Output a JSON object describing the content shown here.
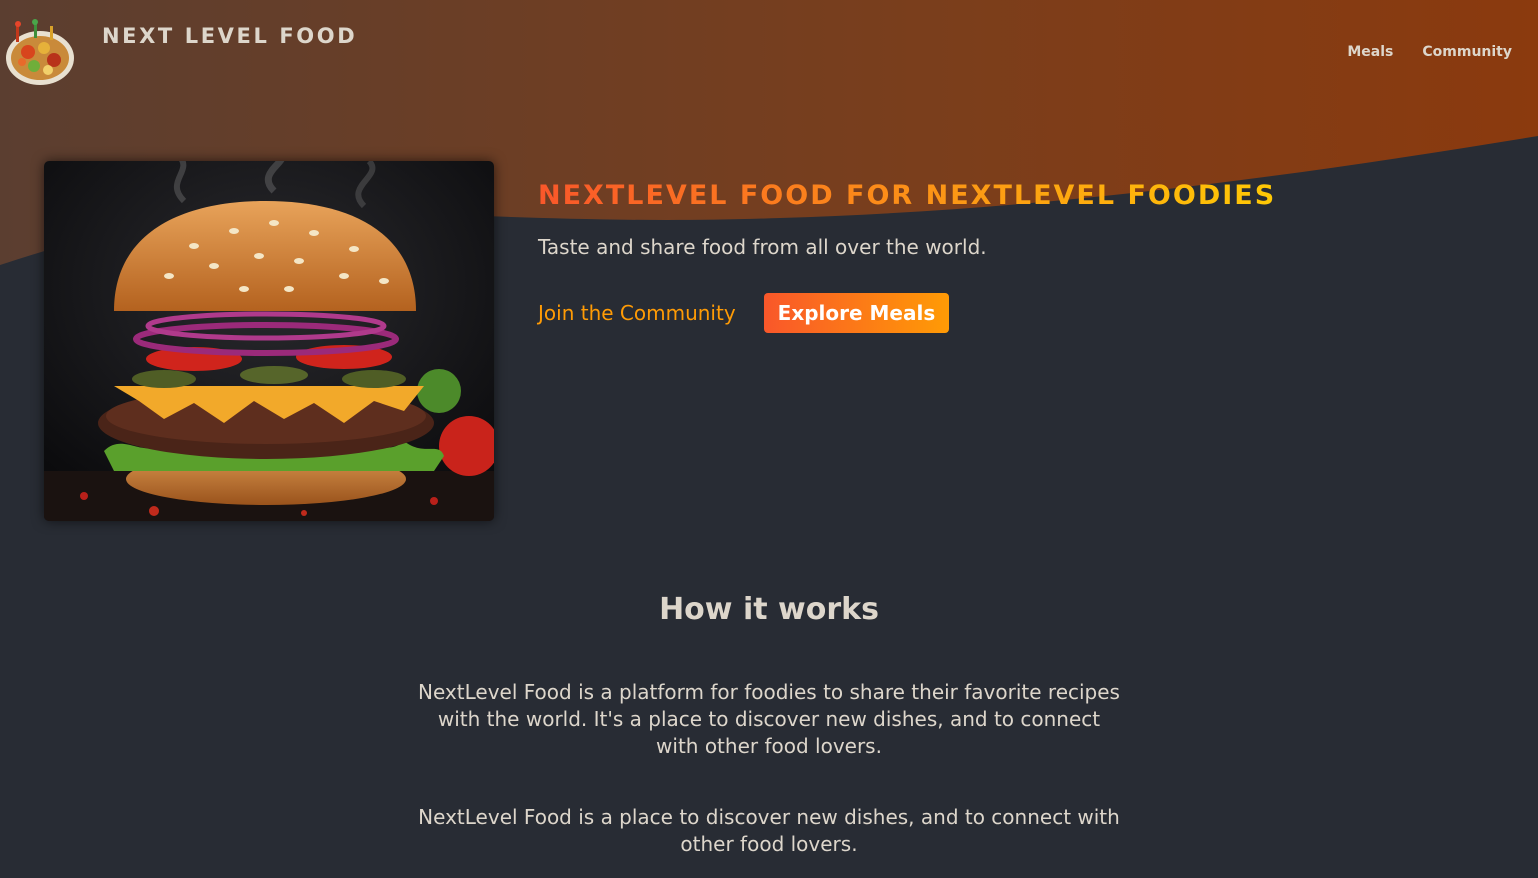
{
  "header": {
    "logo_alt": "A plate with food on it",
    "logo_text": "NEXT LEVEL FOOD",
    "nav": [
      {
        "label": "Meals"
      },
      {
        "label": "Community"
      }
    ]
  },
  "hero": {
    "image_alt": "A delicious burger",
    "title": "NEXTLEVEL FOOD FOR NEXTLEVEL FOODIES",
    "subtitle": "Taste and share food from all over the world.",
    "join_link": "Join the Community",
    "explore_button": "Explore Meals"
  },
  "how_it_works": {
    "title": "How it works",
    "paragraphs": [
      "NextLevel Food is a platform for foodies to share their favorite recipes with the world. It's a place to discover new dishes, and to connect with other food lovers.",
      "NextLevel Food is a place to discover new dishes, and to connect with other food lovers."
    ]
  },
  "colors": {
    "background": "#282c34",
    "text": "#ddd6cb",
    "accent_start": "#f9572a",
    "accent_end": "#ff9b05",
    "header_gradient_left": "#5b3e2c",
    "header_gradient_right": "#8a3d12"
  }
}
